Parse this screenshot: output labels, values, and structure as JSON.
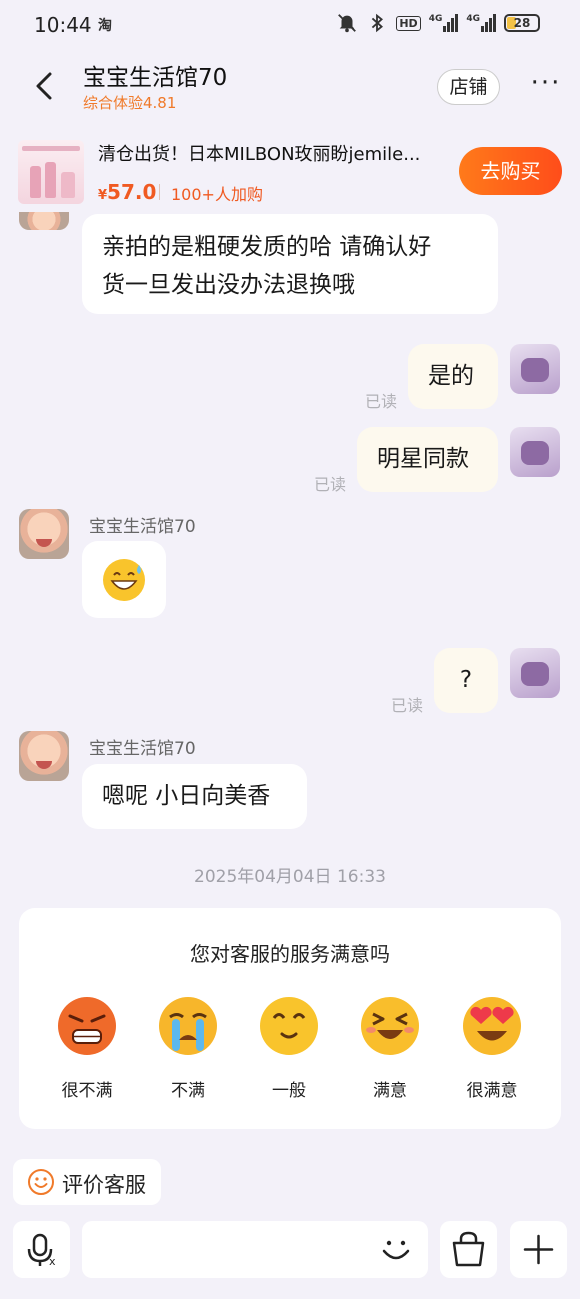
{
  "status_bar": {
    "time": "10:44",
    "app_indicator": "淘",
    "hd_label": "HD",
    "network_1": "4G",
    "network_2": "4G",
    "battery": "28"
  },
  "header": {
    "shop_name": "宝宝生活馆70",
    "rating": "综合体验4.81",
    "store_button": "店铺",
    "more_label": "···"
  },
  "product": {
    "title": "清仓出货！日本MILBON玫丽盼jemile...",
    "price_symbol": "¥",
    "price": "57.0",
    "buyers": "100+人加购",
    "buy_button": "去购买"
  },
  "messages": {
    "m1_line1": "亲拍的是粗硬发质的哈  请确认好",
    "m1_line2": "货一旦发出没办法退换哦",
    "m2": "是的",
    "m3": "明星同款",
    "m4_sender": "宝宝生活馆70",
    "m5": "?",
    "m6_sender": "宝宝生活馆70",
    "m6": "嗯呢  小日向美香",
    "read_mark": "已读"
  },
  "timestamp": "2025年04月04日 16:33",
  "survey": {
    "title": "您对客服的服务满意吗",
    "options": [
      {
        "label": "很不满",
        "icon": "angry-emoji-icon",
        "color": "#ef6a2a"
      },
      {
        "label": "不满",
        "icon": "crying-emoji-icon",
        "color": "#f7b62b"
      },
      {
        "label": "一般",
        "icon": "neutral-emoji-icon",
        "color": "#f9c42c"
      },
      {
        "label": "满意",
        "icon": "happy-emoji-icon",
        "color": "#f9be2c"
      },
      {
        "label": "很满意",
        "icon": "heart-eyes-emoji-icon",
        "color": "#f8b92a"
      }
    ]
  },
  "review_button": "评价客服",
  "input": {
    "placeholder": ""
  },
  "colors": {
    "accent": "#f05a22",
    "background": "#f3f1f9",
    "outgoing_bubble": "#fdf9ee"
  }
}
